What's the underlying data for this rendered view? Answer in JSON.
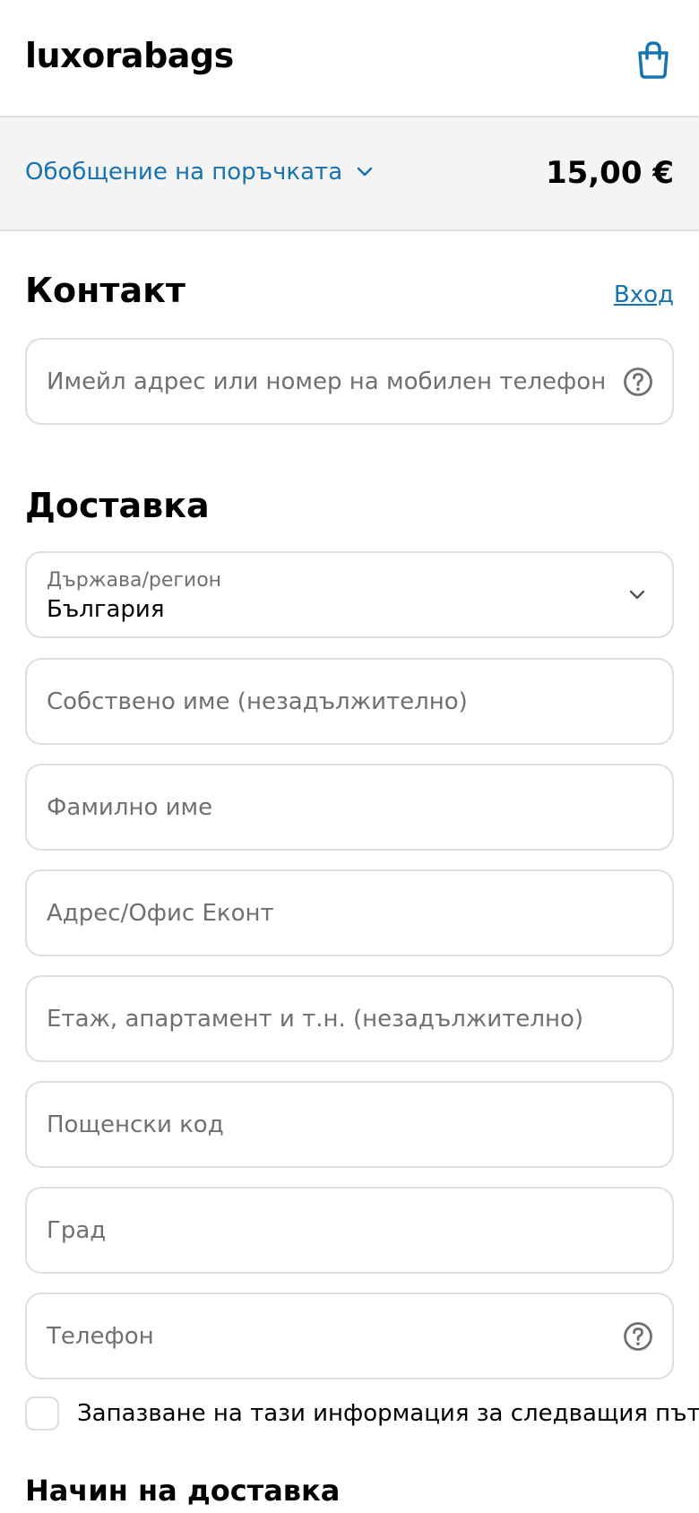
{
  "header": {
    "brand": "luxorabags",
    "cart_icon": "shopping-bag-icon",
    "accent_color": "#1773b0"
  },
  "summary": {
    "toggle_label": "Обобщение на поръчката",
    "total": "15,00 €",
    "chevron_icon": "chevron-down-icon"
  },
  "contact": {
    "title": "Контакт",
    "login_label": "Вход",
    "email_placeholder": "Имейл адрес или номер на мобилен телефон",
    "help_icon": "question-circle-icon"
  },
  "delivery": {
    "title": "Доставка",
    "country_label": "Държава/регион",
    "country_value": "България",
    "first_name_placeholder": "Собствено име (незадължително)",
    "last_name_placeholder": "Фамилно име",
    "address_placeholder": "Адрес/Офис Еконт",
    "apartment_placeholder": "Етаж, апартамент и т.н. (незадължително)",
    "postal_code_placeholder": "Пощенски код",
    "city_placeholder": "Град",
    "phone_placeholder": "Телефон",
    "save_info_label": "Запазване на тази информация за следващия път",
    "save_info_checked": false
  },
  "shipping_method": {
    "title": "Начин на доставка"
  }
}
